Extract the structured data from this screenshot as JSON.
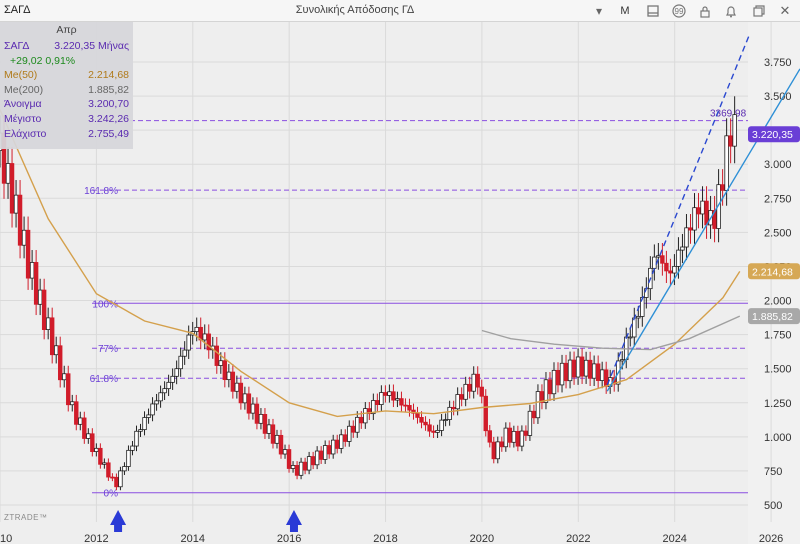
{
  "titlebar": {
    "symbol": "ΣΑΓΔ",
    "title": "Συνολικής Απόδοσης ΓΔ",
    "buttons": [
      "M"
    ]
  },
  "info_panel": {
    "header": "Απρ",
    "symbol": "ΣΑΓΔ",
    "price": "3.220,35",
    "period": "Μήνας",
    "change": "+29,02",
    "change_pct": "0,91%",
    "ma50_label": "Me(50)",
    "ma50_value": "2.214,68",
    "ma200_label": "Me(200)",
    "ma200_value": "1.885,82",
    "open_label": "Άνοιγμα",
    "open_value": "3.200,70",
    "high_label": "Μέγιστο",
    "high_value": "3.242,26",
    "low_label": "Ελάχιστο",
    "low_value": "2.755,49"
  },
  "logo": "ZTRADE™",
  "chart_data": {
    "type": "candlestick",
    "x_range": [
      2010.0,
      2026.6
    ],
    "y_range": [
      480,
      3950
    ],
    "y_ticks": [
      {
        "v": 3750,
        "l": "3.750"
      },
      {
        "v": 3500,
        "l": "3.500"
      },
      {
        "v": 3250,
        "l": "3.250"
      },
      {
        "v": 3000,
        "l": "3.000"
      },
      {
        "v": 2750,
        "l": "2.750"
      },
      {
        "v": 2500,
        "l": "2.500"
      },
      {
        "v": 2250,
        "l": "2.250"
      },
      {
        "v": 2000,
        "l": "2.000"
      },
      {
        "v": 1750,
        "l": "1.750"
      },
      {
        "v": 1500,
        "l": "1.500"
      },
      {
        "v": 1250,
        "l": "1.250"
      },
      {
        "v": 1000,
        "l": "1.000"
      },
      {
        "v": 750,
        "l": "750"
      },
      {
        "v": 500,
        "l": "500"
      }
    ],
    "x_ticks": [
      {
        "v": 2010,
        "l": "2010"
      },
      {
        "v": 2012,
        "l": "2012"
      },
      {
        "v": 2014,
        "l": "2014"
      },
      {
        "v": 2016,
        "l": "2016"
      },
      {
        "v": 2018,
        "l": "2018"
      },
      {
        "v": 2020,
        "l": "2020"
      },
      {
        "v": 2022,
        "l": "2022"
      },
      {
        "v": 2024,
        "l": "2024"
      },
      {
        "v": 2026,
        "l": "2026"
      }
    ],
    "fib_levels": [
      {
        "label": "0%",
        "value": 590,
        "style": "solid"
      },
      {
        "label": "61.8%",
        "value": 1430,
        "style": "dashed"
      },
      {
        "label": "77%",
        "value": 1650,
        "style": "dashed"
      },
      {
        "label": "100%",
        "value": 1980,
        "style": "solid"
      },
      {
        "label": "161.8%",
        "value": 2810,
        "style": "dashed"
      }
    ],
    "peak_level": {
      "label": "3369.98",
      "value": 3320
    },
    "price_tags": [
      {
        "value": 3220.35,
        "label": "3.220,35",
        "color": "#6a3fd6"
      },
      {
        "value": 2214.68,
        "label": "2.214,68",
        "color": "#d6a855"
      },
      {
        "value": 1885.82,
        "label": "1.885,82",
        "color": "#a8a8a8"
      }
    ],
    "series": [
      {
        "name": "Me(50)",
        "color": "#d4a04c",
        "points": [
          [
            2010.0,
            3400
          ],
          [
            2011.0,
            2600
          ],
          [
            2012.0,
            2050
          ],
          [
            2013.0,
            1850
          ],
          [
            2014.0,
            1760
          ],
          [
            2015.0,
            1480
          ],
          [
            2016.0,
            1250
          ],
          [
            2017.0,
            1150
          ],
          [
            2018.0,
            1190
          ],
          [
            2019.0,
            1170
          ],
          [
            2020.0,
            1215
          ],
          [
            2021.0,
            1245
          ],
          [
            2022.0,
            1310
          ],
          [
            2023.0,
            1420
          ],
          [
            2024.0,
            1680
          ],
          [
            2025.0,
            2020
          ],
          [
            2025.35,
            2214
          ]
        ]
      },
      {
        "name": "Me(200)",
        "color": "#a0a0a0",
        "points": [
          [
            2020.0,
            1780
          ],
          [
            2020.6,
            1720
          ],
          [
            2021.5,
            1680
          ],
          [
            2022.5,
            1650
          ],
          [
            2023.5,
            1640
          ],
          [
            2024.3,
            1720
          ],
          [
            2025.35,
            1886
          ]
        ]
      }
    ],
    "trend_lines": [
      {
        "style": "dashed",
        "color": "#2a48d0",
        "from": [
          2022.6,
          1380
        ],
        "to": [
          2025.55,
          3950
        ]
      },
      {
        "style": "solid",
        "color": "#2d8fd6",
        "from": [
          2022.6,
          1335
        ],
        "to": [
          2026.6,
          3700
        ]
      }
    ],
    "arrows": [
      {
        "x": 2012.45,
        "label": "buy-arrow"
      },
      {
        "x": 2016.1,
        "label": "buy-arrow"
      }
    ],
    "anchors": [
      {
        "x": 2012.4,
        "y": 570
      },
      {
        "x": 2016.0,
        "y": 570
      },
      {
        "x": 2020.0,
        "y": 3860
      },
      {
        "x": 2020.0,
        "y": 3680
      },
      {
        "x": 2020.0,
        "y": 3430
      },
      {
        "x": 2020.0,
        "y": 3250
      },
      {
        "x": 2020.0,
        "y": 3050
      },
      {
        "x": 2020.0,
        "y": 2840
      },
      {
        "x": 2020.2,
        "y": 2620
      },
      {
        "x": 2020.4,
        "y": 2470
      },
      {
        "x": 2020.6,
        "y": 2200
      },
      {
        "x": 2020.8,
        "y": 2050
      },
      {
        "x": 2021.0,
        "y": 1820
      },
      {
        "x": 2011.0,
        "y": 1450
      },
      {
        "x": 2011.5,
        "y": 1120
      },
      {
        "x": 2012.0,
        "y": 900
      },
      {
        "x": 2012.5,
        "y": 700
      },
      {
        "x": 2013.0,
        "y": 1150
      },
      {
        "x": 2013.5,
        "y": 1400
      },
      {
        "x": 2014.0,
        "y": 1850
      },
      {
        "x": 2014.5,
        "y": 1520
      },
      {
        "x": 2015.0,
        "y": 1280
      },
      {
        "x": 2015.5,
        "y": 1100
      },
      {
        "x": 2016.3,
        "y": 780
      },
      {
        "x": 2017.0,
        "y": 900
      },
      {
        "x": 2017.5,
        "y": 1180
      },
      {
        "x": 2018.0,
        "y": 1320
      },
      {
        "x": 2018.5,
        "y": 1200
      },
      {
        "x": 2019.0,
        "y": 1000
      },
      {
        "x": 2019.5,
        "y": 1300
      },
      {
        "x": 2020.0,
        "y": 1450
      },
      {
        "x": 2020.2,
        "y": 820
      },
      {
        "x": 2020.5,
        "y": 1000
      },
      {
        "x": 2020.8,
        "y": 960
      },
      {
        "x": 2021.3,
        "y": 1350
      },
      {
        "x": 2021.8,
        "y": 1480
      },
      {
        "x": 2022.3,
        "y": 1500
      },
      {
        "x": 2022.7,
        "y": 1380
      },
      {
        "x": 2023.0,
        "y": 1700
      },
      {
        "x": 2023.3,
        "y": 1950
      },
      {
        "x": 2023.6,
        "y": 2350
      },
      {
        "x": 2023.9,
        "y": 2200
      },
      {
        "x": 2024.2,
        "y": 2450
      },
      {
        "x": 2024.5,
        "y": 2700
      },
      {
        "x": 2024.8,
        "y": 2550
      },
      {
        "x": 2025.0,
        "y": 2900
      },
      {
        "x": 2025.15,
        "y": 3250
      },
      {
        "x": 2025.3,
        "y": 3220
      }
    ]
  }
}
